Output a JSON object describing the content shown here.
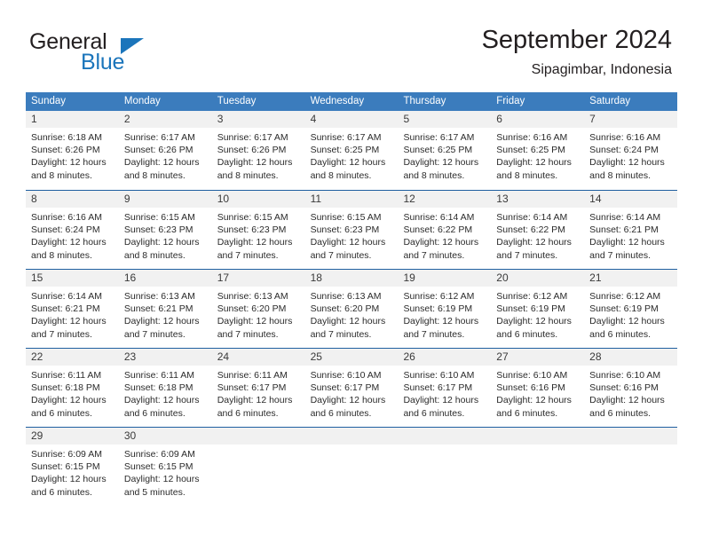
{
  "brand": {
    "name_part1": "General",
    "name_part2": "Blue",
    "accent_color": "#1b75bb"
  },
  "header": {
    "title": "September 2024",
    "subtitle": "Sipagimbar, Indonesia"
  },
  "theme": {
    "header_row_bg": "#3b7cbd",
    "row_divider": "#1f5fa0",
    "day_number_bg": "#f1f1f1"
  },
  "calendar": {
    "weekdays": [
      "Sunday",
      "Monday",
      "Tuesday",
      "Wednesday",
      "Thursday",
      "Friday",
      "Saturday"
    ],
    "weeks": [
      [
        {
          "day": "1",
          "sunrise": "Sunrise: 6:18 AM",
          "sunset": "Sunset: 6:26 PM",
          "daylight": "Daylight: 12 hours and 8 minutes."
        },
        {
          "day": "2",
          "sunrise": "Sunrise: 6:17 AM",
          "sunset": "Sunset: 6:26 PM",
          "daylight": "Daylight: 12 hours and 8 minutes."
        },
        {
          "day": "3",
          "sunrise": "Sunrise: 6:17 AM",
          "sunset": "Sunset: 6:26 PM",
          "daylight": "Daylight: 12 hours and 8 minutes."
        },
        {
          "day": "4",
          "sunrise": "Sunrise: 6:17 AM",
          "sunset": "Sunset: 6:25 PM",
          "daylight": "Daylight: 12 hours and 8 minutes."
        },
        {
          "day": "5",
          "sunrise": "Sunrise: 6:17 AM",
          "sunset": "Sunset: 6:25 PM",
          "daylight": "Daylight: 12 hours and 8 minutes."
        },
        {
          "day": "6",
          "sunrise": "Sunrise: 6:16 AM",
          "sunset": "Sunset: 6:25 PM",
          "daylight": "Daylight: 12 hours and 8 minutes."
        },
        {
          "day": "7",
          "sunrise": "Sunrise: 6:16 AM",
          "sunset": "Sunset: 6:24 PM",
          "daylight": "Daylight: 12 hours and 8 minutes."
        }
      ],
      [
        {
          "day": "8",
          "sunrise": "Sunrise: 6:16 AM",
          "sunset": "Sunset: 6:24 PM",
          "daylight": "Daylight: 12 hours and 8 minutes."
        },
        {
          "day": "9",
          "sunrise": "Sunrise: 6:15 AM",
          "sunset": "Sunset: 6:23 PM",
          "daylight": "Daylight: 12 hours and 8 minutes."
        },
        {
          "day": "10",
          "sunrise": "Sunrise: 6:15 AM",
          "sunset": "Sunset: 6:23 PM",
          "daylight": "Daylight: 12 hours and 7 minutes."
        },
        {
          "day": "11",
          "sunrise": "Sunrise: 6:15 AM",
          "sunset": "Sunset: 6:23 PM",
          "daylight": "Daylight: 12 hours and 7 minutes."
        },
        {
          "day": "12",
          "sunrise": "Sunrise: 6:14 AM",
          "sunset": "Sunset: 6:22 PM",
          "daylight": "Daylight: 12 hours and 7 minutes."
        },
        {
          "day": "13",
          "sunrise": "Sunrise: 6:14 AM",
          "sunset": "Sunset: 6:22 PM",
          "daylight": "Daylight: 12 hours and 7 minutes."
        },
        {
          "day": "14",
          "sunrise": "Sunrise: 6:14 AM",
          "sunset": "Sunset: 6:21 PM",
          "daylight": "Daylight: 12 hours and 7 minutes."
        }
      ],
      [
        {
          "day": "15",
          "sunrise": "Sunrise: 6:14 AM",
          "sunset": "Sunset: 6:21 PM",
          "daylight": "Daylight: 12 hours and 7 minutes."
        },
        {
          "day": "16",
          "sunrise": "Sunrise: 6:13 AM",
          "sunset": "Sunset: 6:21 PM",
          "daylight": "Daylight: 12 hours and 7 minutes."
        },
        {
          "day": "17",
          "sunrise": "Sunrise: 6:13 AM",
          "sunset": "Sunset: 6:20 PM",
          "daylight": "Daylight: 12 hours and 7 minutes."
        },
        {
          "day": "18",
          "sunrise": "Sunrise: 6:13 AM",
          "sunset": "Sunset: 6:20 PM",
          "daylight": "Daylight: 12 hours and 7 minutes."
        },
        {
          "day": "19",
          "sunrise": "Sunrise: 6:12 AM",
          "sunset": "Sunset: 6:19 PM",
          "daylight": "Daylight: 12 hours and 7 minutes."
        },
        {
          "day": "20",
          "sunrise": "Sunrise: 6:12 AM",
          "sunset": "Sunset: 6:19 PM",
          "daylight": "Daylight: 12 hours and 6 minutes."
        },
        {
          "day": "21",
          "sunrise": "Sunrise: 6:12 AM",
          "sunset": "Sunset: 6:19 PM",
          "daylight": "Daylight: 12 hours and 6 minutes."
        }
      ],
      [
        {
          "day": "22",
          "sunrise": "Sunrise: 6:11 AM",
          "sunset": "Sunset: 6:18 PM",
          "daylight": "Daylight: 12 hours and 6 minutes."
        },
        {
          "day": "23",
          "sunrise": "Sunrise: 6:11 AM",
          "sunset": "Sunset: 6:18 PM",
          "daylight": "Daylight: 12 hours and 6 minutes."
        },
        {
          "day": "24",
          "sunrise": "Sunrise: 6:11 AM",
          "sunset": "Sunset: 6:17 PM",
          "daylight": "Daylight: 12 hours and 6 minutes."
        },
        {
          "day": "25",
          "sunrise": "Sunrise: 6:10 AM",
          "sunset": "Sunset: 6:17 PM",
          "daylight": "Daylight: 12 hours and 6 minutes."
        },
        {
          "day": "26",
          "sunrise": "Sunrise: 6:10 AM",
          "sunset": "Sunset: 6:17 PM",
          "daylight": "Daylight: 12 hours and 6 minutes."
        },
        {
          "day": "27",
          "sunrise": "Sunrise: 6:10 AM",
          "sunset": "Sunset: 6:16 PM",
          "daylight": "Daylight: 12 hours and 6 minutes."
        },
        {
          "day": "28",
          "sunrise": "Sunrise: 6:10 AM",
          "sunset": "Sunset: 6:16 PM",
          "daylight": "Daylight: 12 hours and 6 minutes."
        }
      ],
      [
        {
          "day": "29",
          "sunrise": "Sunrise: 6:09 AM",
          "sunset": "Sunset: 6:15 PM",
          "daylight": "Daylight: 12 hours and 6 minutes."
        },
        {
          "day": "30",
          "sunrise": "Sunrise: 6:09 AM",
          "sunset": "Sunset: 6:15 PM",
          "daylight": "Daylight: 12 hours and 5 minutes."
        },
        {
          "day": "",
          "sunrise": "",
          "sunset": "",
          "daylight": ""
        },
        {
          "day": "",
          "sunrise": "",
          "sunset": "",
          "daylight": ""
        },
        {
          "day": "",
          "sunrise": "",
          "sunset": "",
          "daylight": ""
        },
        {
          "day": "",
          "sunrise": "",
          "sunset": "",
          "daylight": ""
        },
        {
          "day": "",
          "sunrise": "",
          "sunset": "",
          "daylight": ""
        }
      ]
    ]
  }
}
